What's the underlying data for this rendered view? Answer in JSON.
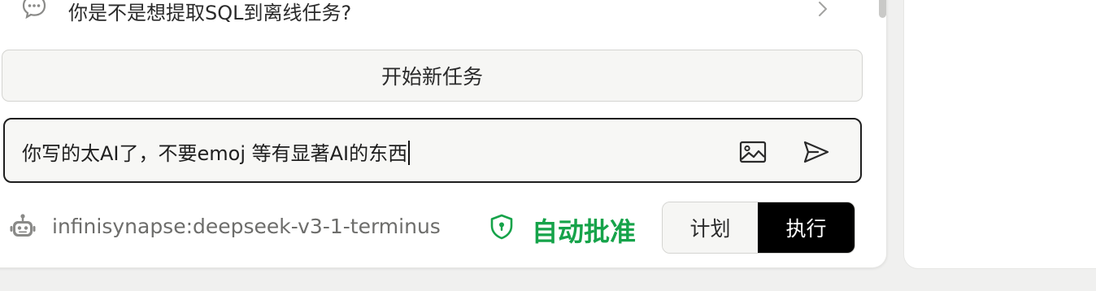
{
  "suggestion": {
    "text": "你是不是想提取SQL到离线任务?"
  },
  "new_task": {
    "label": "开始新任务"
  },
  "chat_input": {
    "value": "你写的太AI了，不要emoj 等有显著AI的东西"
  },
  "model": {
    "name": "infinisynapse:deepseek-v3-1-terminus"
  },
  "approval": {
    "label": "自动批准",
    "color": "#16a34a"
  },
  "modes": {
    "plan_label": "计划",
    "execute_label": "执行",
    "active": "执行"
  },
  "icons": {
    "suggestion": "chat-bubble-icon",
    "chevron": "chevron-right-icon",
    "image": "image-icon",
    "send": "send-icon",
    "robot": "robot-icon",
    "shield": "shield-icon"
  }
}
